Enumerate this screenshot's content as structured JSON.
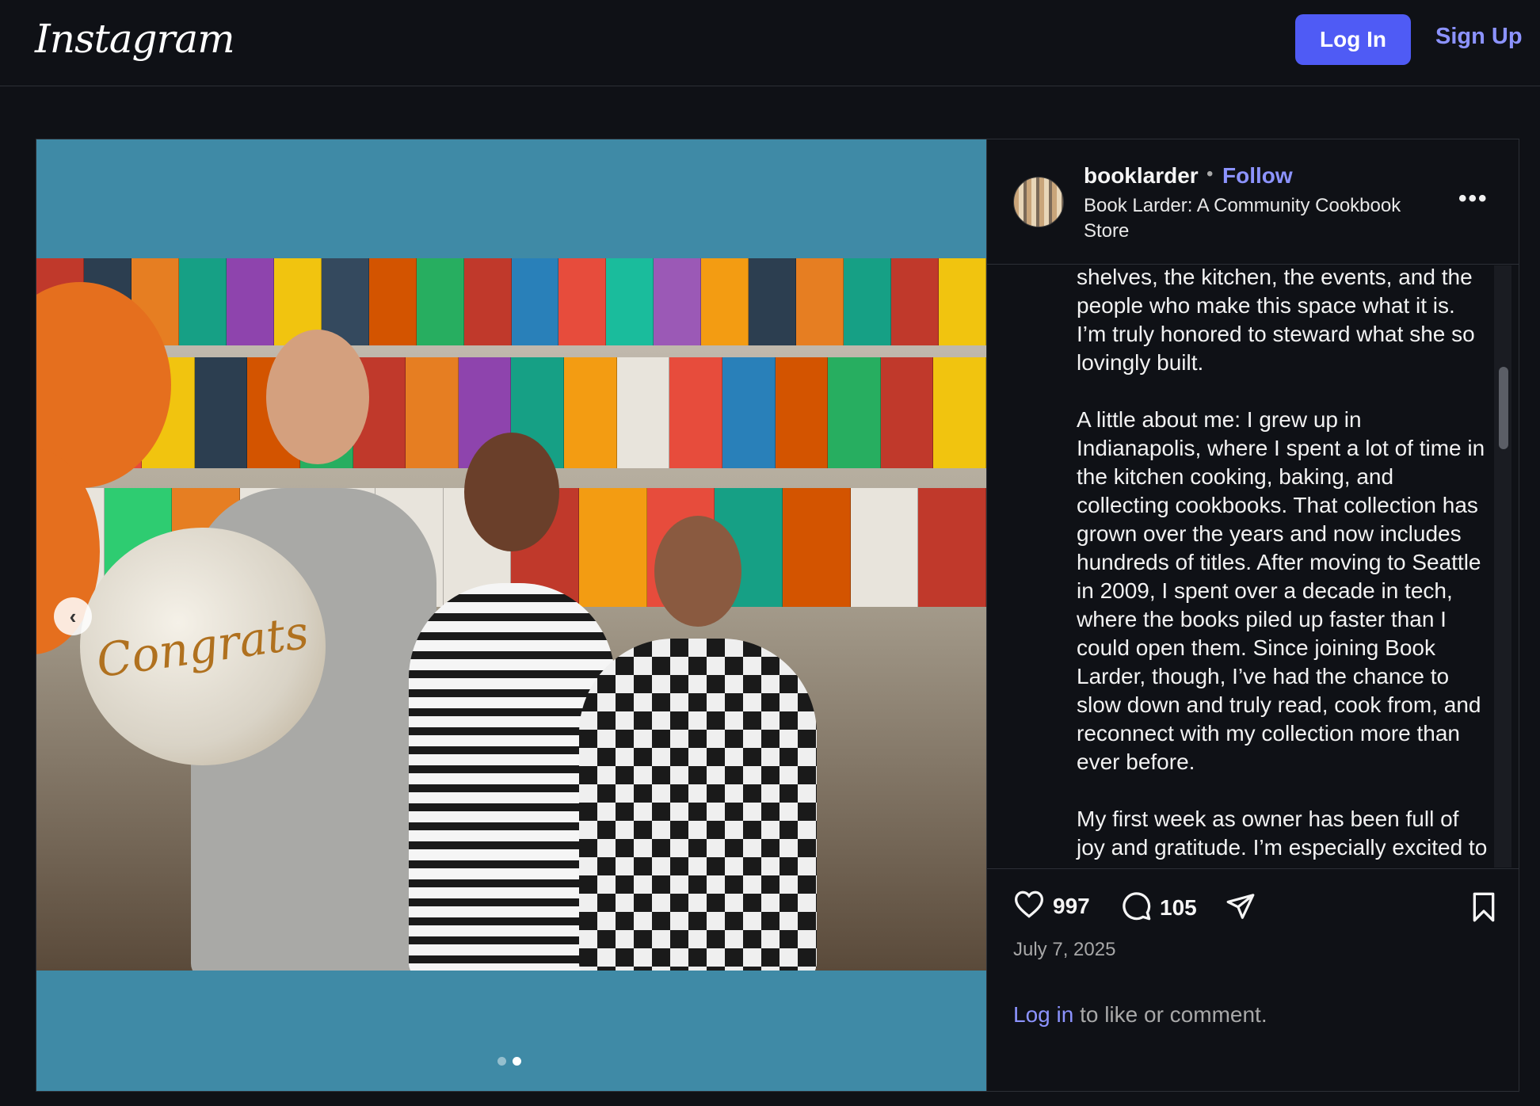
{
  "app": {
    "logo": "Instagram"
  },
  "header": {
    "login_label": "Log In",
    "signup_label": "Sign Up"
  },
  "post": {
    "username": "booklarder",
    "separator": "•",
    "follow_label": "Follow",
    "subtitle": "Book Larder: A Community Cookbook Store",
    "more_label": "•••",
    "media": {
      "balloon_text": "Congrats",
      "slide_count": 2,
      "active_slide": 2
    },
    "caption": "shelves, the kitchen, the events, and the people who make this space what it is. I’m truly honored to steward what she so lovingly built.\n\nA little about me: I grew up in Indianapolis, where I spent a lot of time in the kitchen cooking, baking, and collecting cookbooks. That collection has grown over the years and now includes hundreds of titles. After moving to Seattle in 2009, I spent over a decade in tech, where the books piled up faster than I could open them. Since joining Book Larder, though, I’ve had the chance to slow down and truly read, cook from, and reconnect with my collection more than ever before.\n\nMy first week as owner has been full of joy and gratitude. I’m especially excited to share a few photos from",
    "likes": "997",
    "comments": "105",
    "date": "July 7, 2025",
    "login_prompt_link": "Log in",
    "login_prompt_rest": " to like or comment."
  },
  "icons": [
    "heart-icon",
    "comment-icon",
    "share-icon",
    "bookmark-icon",
    "chevron-left-icon",
    "more-icon"
  ]
}
